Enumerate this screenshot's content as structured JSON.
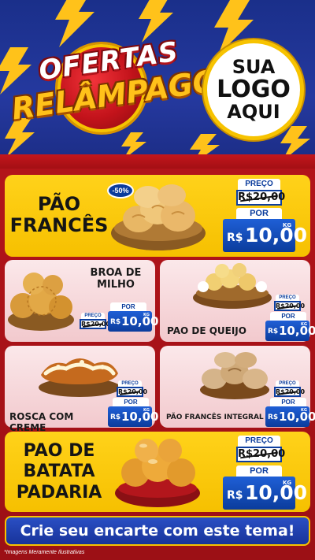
{
  "header": {
    "badge_line1": "OFERTAS",
    "badge_line2": "RELÂMPAGO",
    "logo_line1": "SUA",
    "logo_line2": "LOGO",
    "logo_line3": "AQUI"
  },
  "products": {
    "pao_frances": {
      "name_line1": "PÃO",
      "name_line2": "FRANCÊS",
      "discount": "-50%",
      "preco_label": "PREÇO",
      "old_price": "R$20,00",
      "por_label": "POR",
      "currency": "R$",
      "price": "10,00",
      "unit": "KG"
    },
    "broa": {
      "name_line1": "BROA DE",
      "name_line2": "MILHO",
      "preco_label": "PREÇO",
      "old_price": "R$20,00",
      "por_label": "POR",
      "currency": "R$",
      "price": "10,00",
      "unit": "KG"
    },
    "pao_de_queijo": {
      "name": "PAO DE QUEIJO",
      "preco_label": "PREÇO",
      "old_price": "R$20,00",
      "por_label": "POR",
      "currency": "R$",
      "price": "10,00",
      "unit": "KG"
    },
    "rosca": {
      "name": "ROSCA COM CREME",
      "preco_label": "PREÇO",
      "old_price": "R$20,00",
      "por_label": "POR",
      "currency": "R$",
      "price": "10,00",
      "unit": "KG"
    },
    "pao_integral": {
      "name": "PÃO FRANCÊS INTEGRAL",
      "preco_label": "PREÇO",
      "old_price": "R$20,00",
      "por_label": "POR",
      "currency": "R$",
      "price": "10,00",
      "unit": "KG"
    },
    "pao_batata": {
      "name_line1": "PAO DE",
      "name_line2": "BATATA",
      "name_line3": "PADARIA",
      "preco_label": "PREÇO",
      "old_price": "R$20,00",
      "por_label": "POR",
      "currency": "R$",
      "price": "10,00",
      "unit": "KG"
    }
  },
  "cta": "Crie seu encarte com este tema!",
  "footer_note": "*Imagens Meramente Ilustrativas",
  "icons": {
    "bolt": "lightning-bolt-icon",
    "bread": "bread-basket-illustration"
  },
  "colors": {
    "header_blue": "#25399f",
    "accent_red": "#b3141a",
    "accent_yellow": "#ffd21a",
    "price_blue": "#0b3c9c"
  }
}
